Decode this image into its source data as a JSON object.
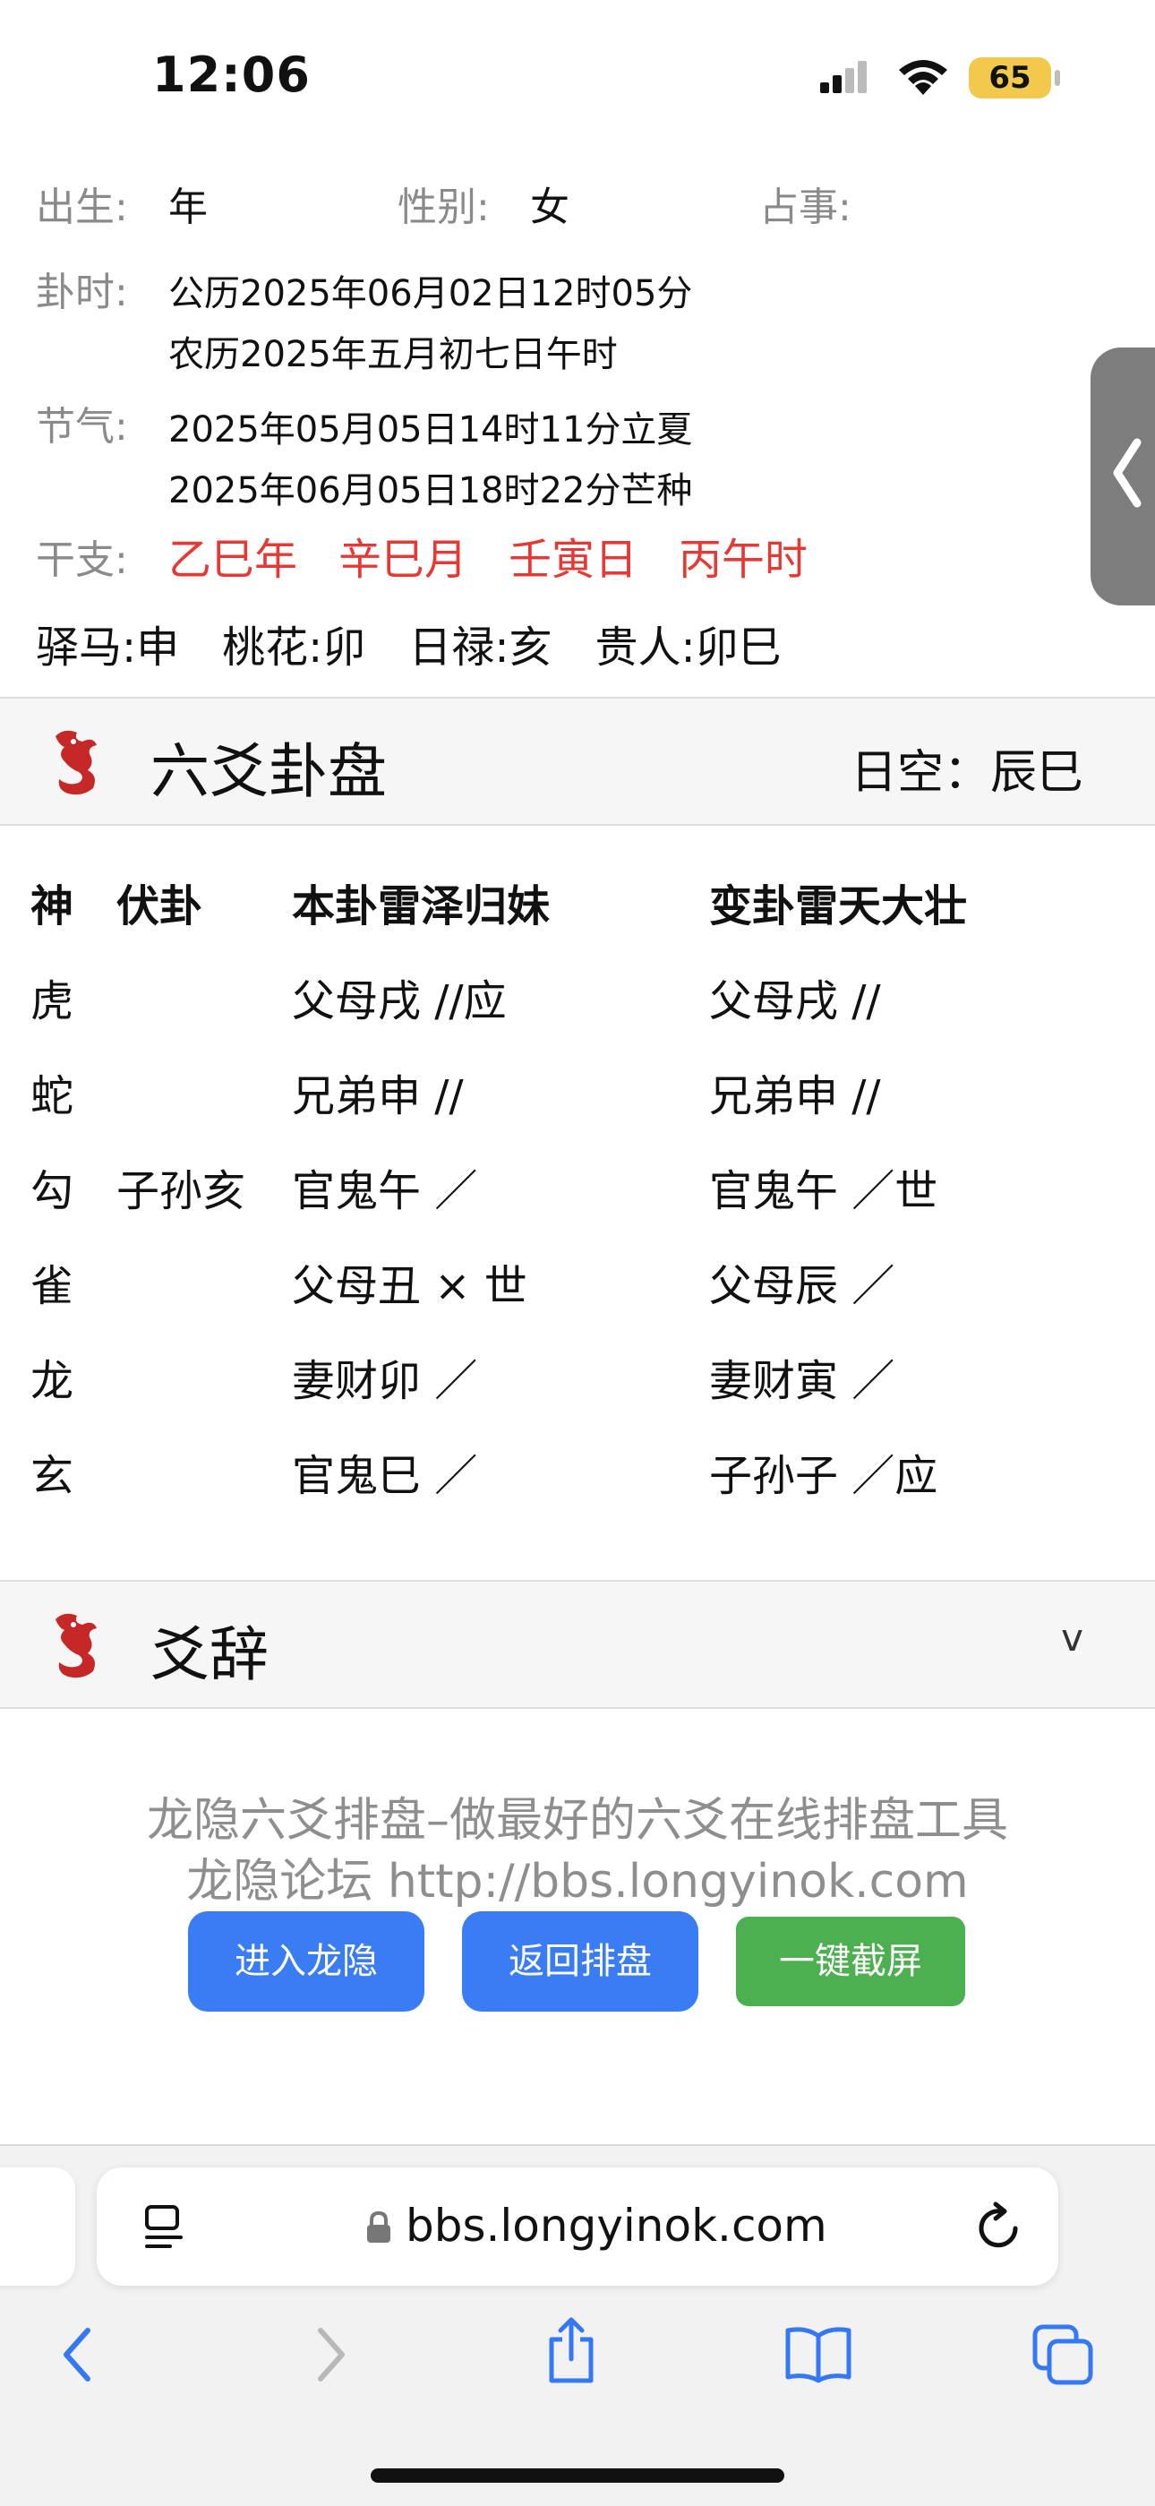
{
  "status": {
    "time": "12:06",
    "battery": "65"
  },
  "info": {
    "birth_label": "出生:",
    "birth_value": "年",
    "gender_label": "性别:",
    "gender_value": "女",
    "matter_label": "占事:",
    "guashi_label": "卦时:",
    "guashi_solar": "公历2025年06月02日12时05分",
    "guashi_lunar": "农历2025年五月初七日午时",
    "jieqi_label": "节气:",
    "jieqi_1": "2025年05月05日14时11分立夏",
    "jieqi_2": "2025年06月05日18时22分芒种",
    "ganzhi_label": "干支:",
    "ganzhi": [
      "乙巳年",
      "辛巳月",
      "壬寅日",
      "丙午时"
    ],
    "shensha": "驿马:申　桃花:卯　日禄:亥　贵人:卯巳"
  },
  "section1": {
    "title": "六爻卦盘",
    "rikong": "日空：辰巳"
  },
  "table": {
    "headers": [
      "神",
      "伏卦",
      "本卦雷泽归妹",
      "变卦雷天大壮"
    ],
    "rows": [
      [
        "虎",
        "",
        "父母戌 //应",
        "父母戌 //"
      ],
      [
        "蛇",
        "",
        "兄弟申 //",
        "兄弟申 //"
      ],
      [
        "勾",
        "子孙亥",
        "官鬼午 ／",
        "官鬼午 ／世"
      ],
      [
        "雀",
        "",
        "父母丑 × 世",
        "父母辰 ／"
      ],
      [
        "龙",
        "",
        "妻财卯 ／",
        "妻财寅 ／"
      ],
      [
        "玄",
        "",
        "官鬼巳 ／",
        "子孙子 ／应"
      ]
    ]
  },
  "section2": {
    "title": "爻辞",
    "caret": "v"
  },
  "footer": {
    "line1": "龙隐六爻排盘–做最好的六爻在线排盘工具",
    "line2": "龙隐论坛 http://bbs.longyinok.com",
    "btn_enter": "进入龙隐",
    "btn_back": "返回排盘",
    "btn_shot": "一键截屏"
  },
  "browser": {
    "url": "bbs.longyinok.com"
  },
  "colors": {
    "accent_red": "#e53935",
    "btn_blue": "#3a7cf4",
    "btn_green": "#4caf50",
    "ios_blue": "#3478f6"
  }
}
